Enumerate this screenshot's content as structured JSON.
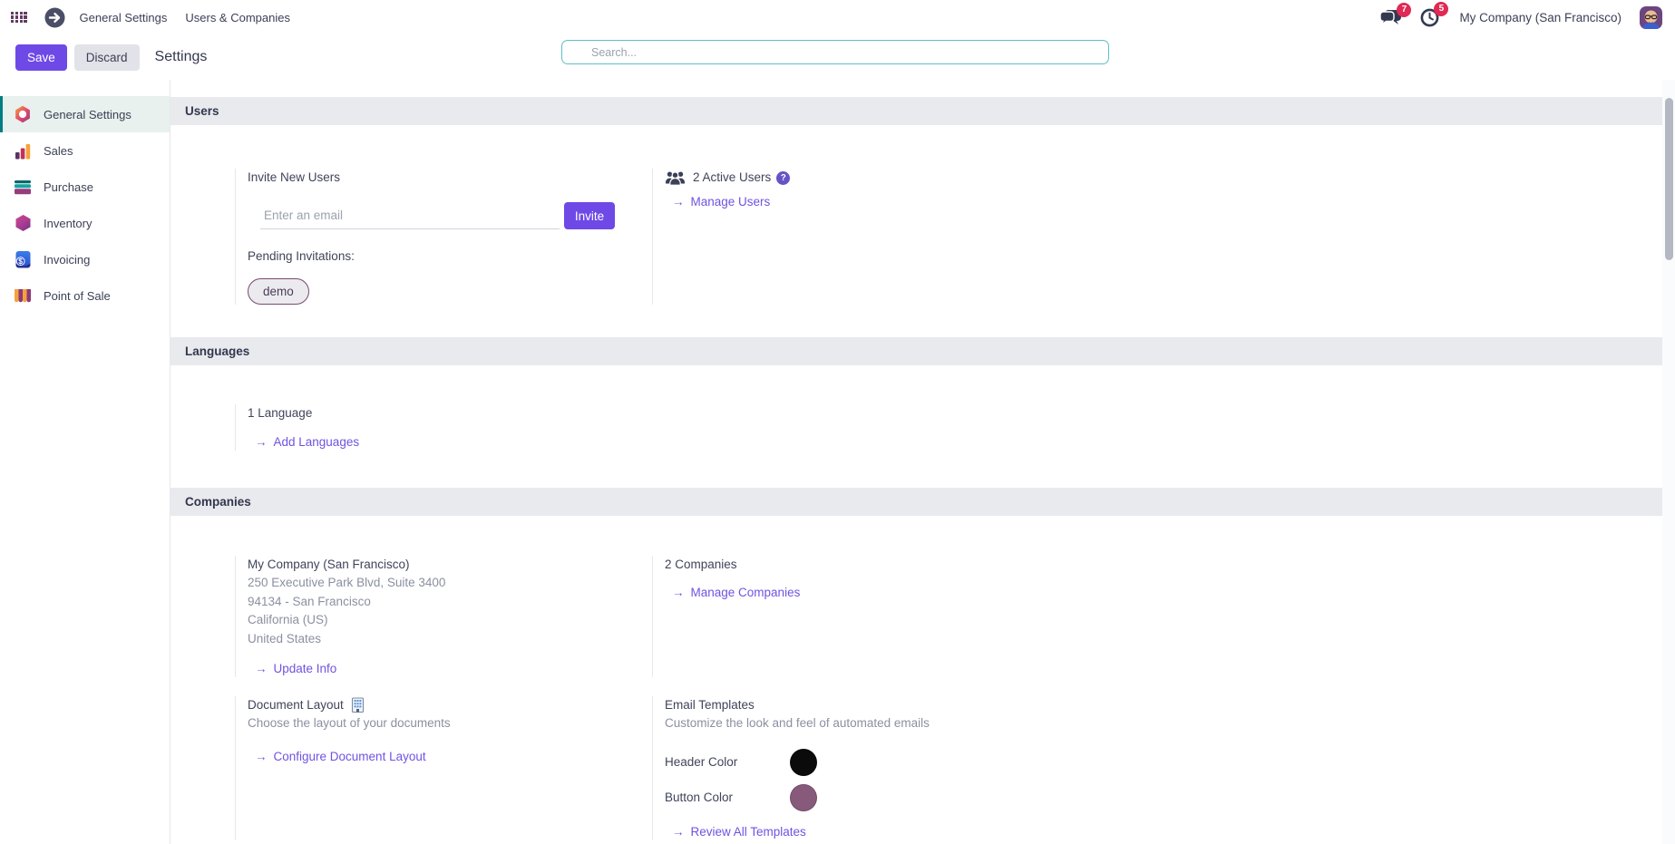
{
  "icons": {
    "link_arrow": "→",
    "help_glyph": "?"
  },
  "topbar": {
    "menu_items": [
      {
        "label": "General Settings"
      },
      {
        "label": "Users & Companies"
      }
    ],
    "message_count": "7",
    "activity_count": "5",
    "company": "My Company (San Francisco)"
  },
  "controlbar": {
    "save_label": "Save",
    "discard_label": "Discard",
    "title": "Settings",
    "search_placeholder": "Search..."
  },
  "sidebar": {
    "items": [
      {
        "label": "General Settings",
        "icon": "general-settings-icon",
        "selected": true
      },
      {
        "label": "Sales",
        "icon": "sales-icon",
        "selected": false
      },
      {
        "label": "Purchase",
        "icon": "purchase-icon",
        "selected": false
      },
      {
        "label": "Inventory",
        "icon": "inventory-icon",
        "selected": false
      },
      {
        "label": "Invoicing",
        "icon": "invoicing-icon",
        "selected": false
      },
      {
        "label": "Point of Sale",
        "icon": "point-of-sale-icon",
        "selected": false
      }
    ]
  },
  "users": {
    "header": "Users",
    "invite_label": "Invite New Users",
    "invite_placeholder": "Enter an email",
    "invite_button": "Invite",
    "pending_label": "Pending Invitations:",
    "pending_tags": [
      {
        "label": "demo"
      }
    ],
    "active_users": "2 Active Users",
    "manage_users": "Manage Users"
  },
  "languages": {
    "header": "Languages",
    "count": "1 Language",
    "add_link": "Add Languages"
  },
  "companies": {
    "header": "Companies",
    "name": "My Company (San Francisco)",
    "address_lines": [
      {
        "text": "250 Executive Park Blvd, Suite 3400"
      },
      {
        "text": "94134 - San Francisco"
      },
      {
        "text": "California (US)"
      },
      {
        "text": "United States"
      }
    ],
    "update_link": "Update Info",
    "count": "2 Companies",
    "manage_link": "Manage Companies"
  },
  "document_layout": {
    "title": "Document Layout",
    "subtitle": "Choose the layout of your documents",
    "configure_link": "Configure Document Layout"
  },
  "email_templates": {
    "title": "Email Templates",
    "subtitle": "Customize the look and feel of automated emails",
    "header_color_label": "Header Color",
    "header_color": "#0b0b0b",
    "button_color_label": "Button Color",
    "button_color": "#875a7b",
    "review_link": "Review All Templates"
  },
  "colors": {
    "accent_purple": "#6e49e6",
    "link_purple": "#7053e0",
    "badge_red": "#e02954",
    "sidebar_selected_border": "#017e84",
    "sidebar_selected_bg": "#e8f1ee",
    "section_band_bg": "#e9eaee",
    "search_border": "#5fbec6"
  }
}
